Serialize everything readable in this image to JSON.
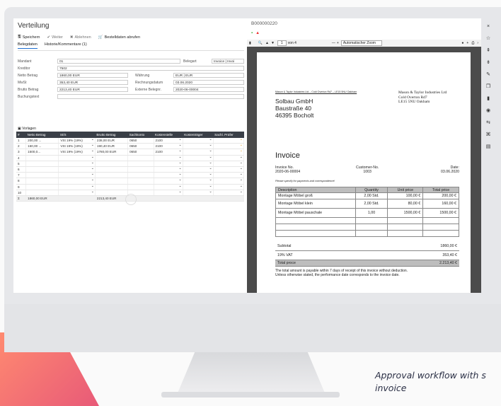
{
  "caption": {
    "line1": "Approval workflow with s",
    "line2": "invoice"
  },
  "app": {
    "title": "Verteilung",
    "toolbar": {
      "save": "Speichern",
      "next": "Weiter",
      "reject": "Ablehnen",
      "fetch": "Bestelldaten abrufen"
    },
    "tabs": [
      "Belegdaten",
      "Historie/Kommentare (1)"
    ],
    "fields": {
      "mandant_label": "Mandant",
      "mandant_value": "01",
      "kreditor_label": "Kreditor",
      "kreditor_value": "7502",
      "netto_label": "Netto Betrag",
      "netto_value": "1860,00 EUR",
      "mwst_label": "MwSt",
      "mwst_value": "353,40 EUR",
      "brutto_label": "Brutto Betrag",
      "brutto_value": "2213,40 EUR",
      "buchungstext_label": "Buchungstext",
      "belegart_label": "Belegart",
      "belegart_value": "Invoice | Invoi",
      "waehrung_label": "Währung",
      "waehrung_value": "EUR | EUR",
      "rechnungsdatum_label": "Rechnungsdatum",
      "rechnungsdatum_value": "03.06.2020",
      "extern_label": "Externe Belegnr.",
      "extern_value": "2020-06-00004"
    },
    "section": "Vorlagen",
    "grid": {
      "headers": [
        "#",
        "Netto Betrag",
        "St/S",
        "Brutto Betrag",
        "Sachkonto",
        "Kostenstelle",
        "Kostenträger",
        "Sachl. Prüfer"
      ],
      "rows": [
        {
          "n": "1",
          "netto": "200,00 ...",
          "st": "VSt 19% (19%)",
          "brutto": "238,00 EUR",
          "konto": "0650",
          "kst": "2100"
        },
        {
          "n": "2",
          "netto": "160,00 ...",
          "st": "VSt 19% (19%)",
          "brutto": "190,40 EUR",
          "konto": "0650",
          "kst": "2100"
        },
        {
          "n": "3",
          "netto": "1500,0...",
          "st": "VSt 19% (19%)",
          "brutto": "1780,00 EUR",
          "konto": "0650",
          "kst": "2100"
        },
        {
          "n": "4"
        },
        {
          "n": "5"
        },
        {
          "n": "6"
        },
        {
          "n": "7"
        },
        {
          "n": "8"
        },
        {
          "n": "9"
        },
        {
          "n": "10"
        }
      ],
      "sum": {
        "label": "Σ",
        "netto": "1860,00 EUR",
        "brutto": "2213,40 EUR"
      }
    }
  },
  "pdf": {
    "doc_id": "B000000220",
    "page_input": "1",
    "page_total": "von 4",
    "zoom": "Automatischer Zoom",
    "sender_line": "Mason & Taylor Industries Ltd – Cold Overton Rd7 – LE15 5NU Oakham",
    "recipient": [
      "Solbau GmbH",
      "Baustraße 40",
      "46395 Bocholt"
    ],
    "sender": [
      "Mason & Taylor Industries Ltd",
      "Cold Overton Rd7",
      "LE15 5NU Oakham"
    ],
    "title": "Invoice",
    "invoice_no_label": "Invoice No.",
    "invoice_no": "2020-06-00004",
    "customer_label": "Customer-No.",
    "customer": "1003",
    "date_label": "Date:",
    "date": "03.06.2020",
    "hint": "Please specify for payments and correspondence!",
    "table_headers": [
      "Description",
      "Quantity",
      "Unit price",
      "Total price"
    ],
    "items": [
      {
        "desc": "Montage Möbel groß",
        "qty": "2,00 Std.",
        "unit": "100,00 €",
        "total": "200,00 €"
      },
      {
        "desc": "Montage Möbel klein",
        "qty": "2,00 Std.",
        "unit": "80,00 €",
        "total": "160,00 €"
      },
      {
        "desc": "Montage Möbel pauschale",
        "qty": "1,00",
        "unit": "1500,00 €",
        "total": "1500,00 €"
      }
    ],
    "subtotal_label": "Subtotal",
    "subtotal": "1860,00 €",
    "vat_label": "19% VAT",
    "vat": "353,40 €",
    "total_label": "Total proce",
    "total": "2.213,40 €",
    "footer1": "The total amount is payable within 7 days of receipt of this invoice without deduction.",
    "footer2": "Unless otherwise stated, the performance date corresponds to the invoice date."
  }
}
